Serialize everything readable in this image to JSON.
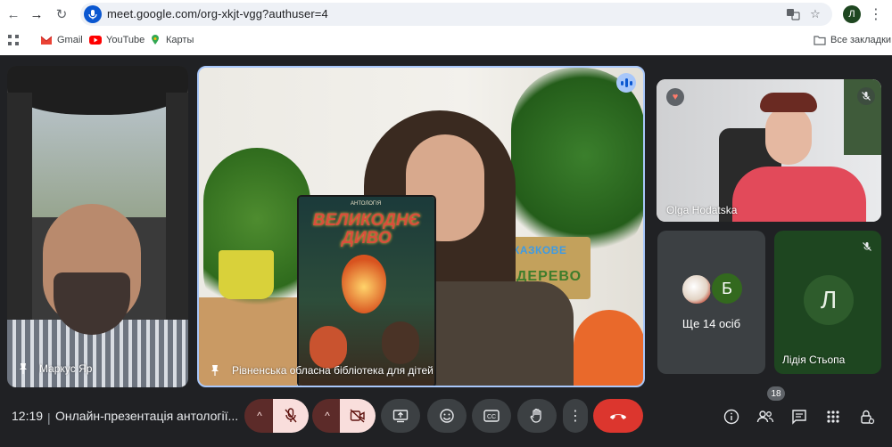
{
  "browser": {
    "url": "meet.google.com/org-xkjt-vgg?authuser=4",
    "profile_initial": "Л",
    "bookmarks": [
      {
        "label": "Gmail"
      },
      {
        "label": "YouTube"
      },
      {
        "label": "Карты"
      }
    ],
    "all_bookmarks": "Все закладки"
  },
  "tiles": {
    "left_participant": "Маркус Яр",
    "main_participant": "Рівненська обласна бібліотека для дітей",
    "book": {
      "small": "АНТОЛОГІЯ",
      "title": "ВЕЛИКОДНЄ ДИВО"
    },
    "sign": {
      "line1": "КАЗКОВЕ",
      "line2": "ДЕРЕВО"
    },
    "top_right_participant": "Olga Hodatska",
    "others": {
      "avatar_letter": "Б",
      "label": "Ще 14 осіб"
    },
    "bottom_right_participant": {
      "initial": "Л",
      "name": "Лідія Стьопа"
    }
  },
  "controls": {
    "time": "12:19",
    "separator": "|",
    "meeting_title": "Онлайн-презентація антології...",
    "participants_count": "18"
  },
  "colors": {
    "background": "#202124",
    "accent": "#a8c7fa",
    "end_call": "#dc362e",
    "muted_bg": "#f9dedc"
  }
}
